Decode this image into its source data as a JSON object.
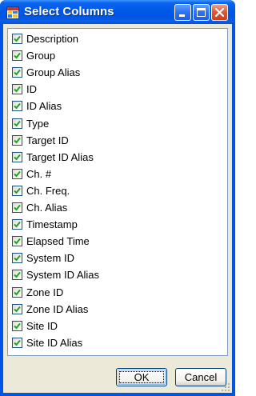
{
  "window": {
    "title": "Select Columns",
    "minimize_icon": "minimize-icon",
    "maximize_icon": "maximize-icon",
    "close_icon": "close-icon",
    "app_icon": "grid-app-icon"
  },
  "columns": [
    {
      "label": "Description",
      "checked": true
    },
    {
      "label": "Group",
      "checked": true
    },
    {
      "label": "Group Alias",
      "checked": true
    },
    {
      "label": "ID",
      "checked": true
    },
    {
      "label": "ID Alias",
      "checked": true
    },
    {
      "label": "Type",
      "checked": true
    },
    {
      "label": "Target ID",
      "checked": true
    },
    {
      "label": "Target ID Alias",
      "checked": true
    },
    {
      "label": "Ch. #",
      "checked": true
    },
    {
      "label": "Ch. Freq.",
      "checked": true
    },
    {
      "label": "Ch. Alias",
      "checked": true
    },
    {
      "label": "Timestamp",
      "checked": true
    },
    {
      "label": "Elapsed Time",
      "checked": true
    },
    {
      "label": "System ID",
      "checked": true
    },
    {
      "label": "System ID Alias",
      "checked": true
    },
    {
      "label": "Zone ID",
      "checked": true
    },
    {
      "label": "Zone ID Alias",
      "checked": true
    },
    {
      "label": "Site ID",
      "checked": true
    },
    {
      "label": "Site ID Alias",
      "checked": true
    }
  ],
  "buttons": {
    "ok_label": "OK",
    "cancel_label": "Cancel"
  },
  "colors": {
    "titlebar": "#0055e5",
    "client": "#ece9d8",
    "check": "#21a121"
  }
}
